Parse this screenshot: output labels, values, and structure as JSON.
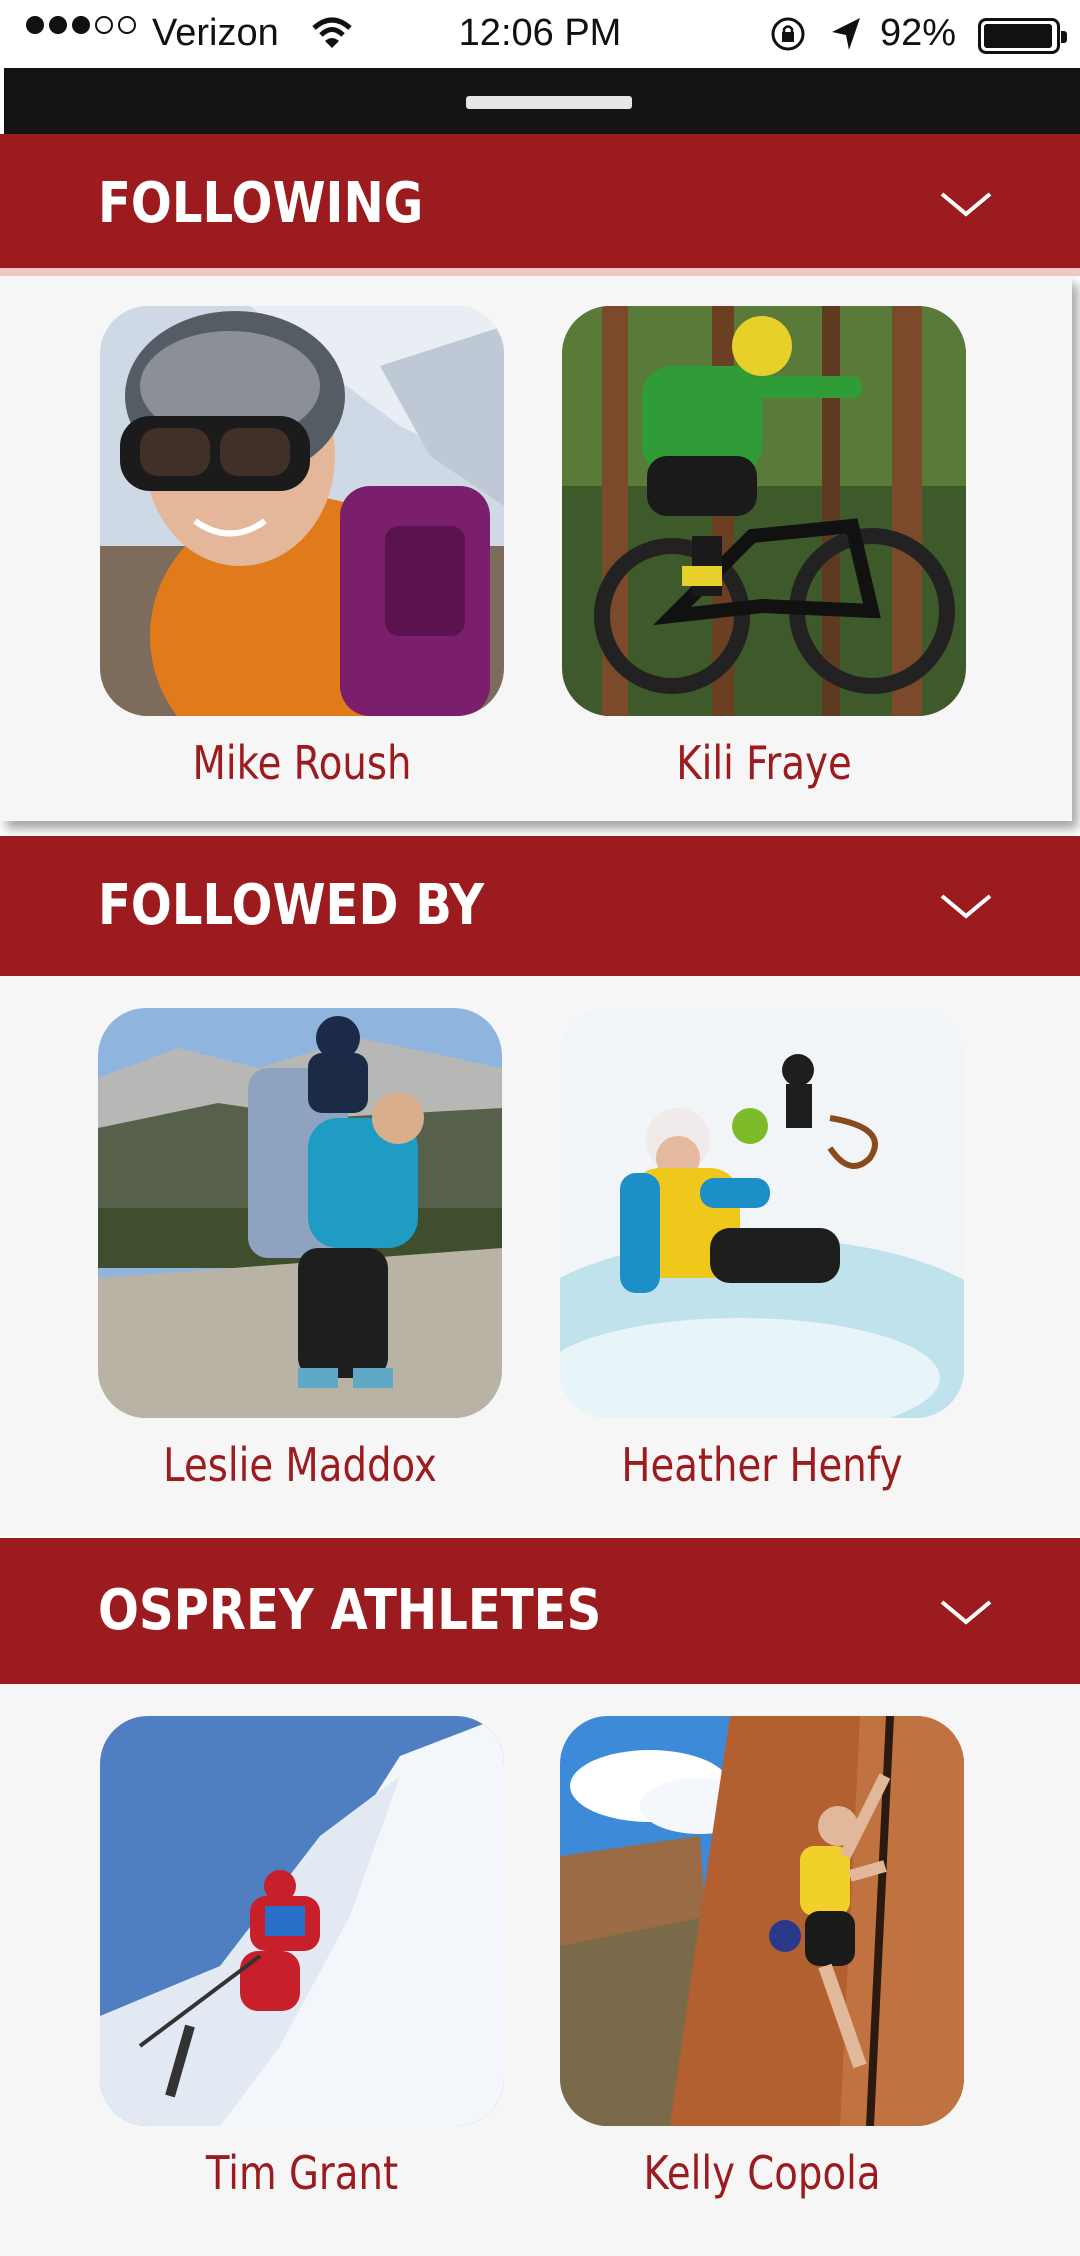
{
  "status_bar": {
    "carrier": "Verizon",
    "time": "12:06 PM",
    "battery": "92%",
    "battery_level": 0.92,
    "signal_bars": 3,
    "signal_total": 5
  },
  "sections": [
    {
      "title": "FOLLOWING",
      "people": [
        {
          "name": "Mike Roush",
          "photo": "skier-with-helmet-and-goggles"
        },
        {
          "name": "Kili Fraye",
          "photo": "mountain-biker-jumping-in-forest"
        }
      ]
    },
    {
      "title": "FOLLOWED BY",
      "people": [
        {
          "name": "Leslie Maddox",
          "photo": "hiker-with-child-carrier-backpack"
        },
        {
          "name": "Heather Henfy",
          "photo": "ice-climber-on-frozen-waterfall"
        }
      ]
    },
    {
      "title": "OSPREY ATHLETES",
      "people": [
        {
          "name": "Tim Grant",
          "photo": "skier-in-powder-snow"
        },
        {
          "name": "Kelly Copola",
          "photo": "rock-climber-on-sandstone-crack"
        }
      ]
    }
  ],
  "colors": {
    "brand_red": "#9b1b1f",
    "header_dark": "#141414",
    "body_bg": "#f6f6f6"
  }
}
